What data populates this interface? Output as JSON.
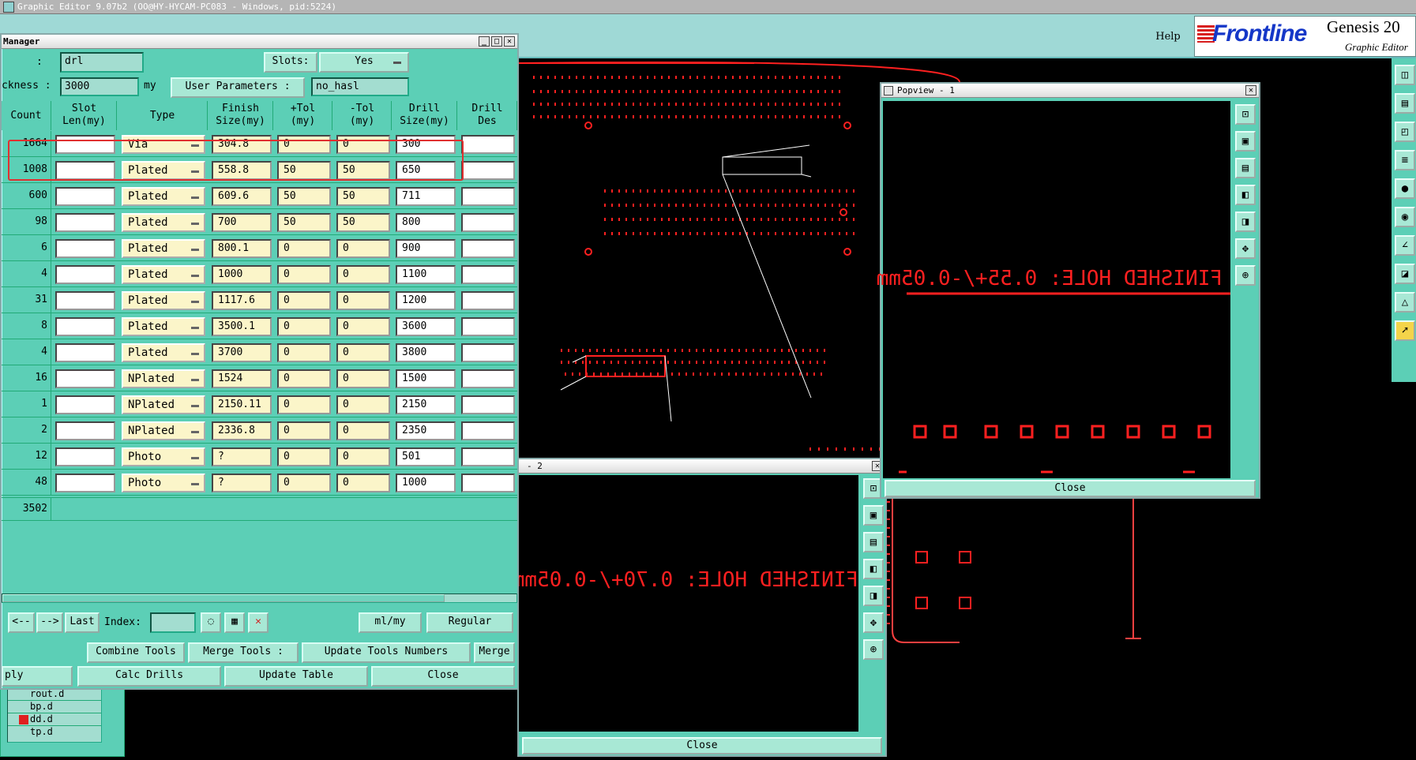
{
  "window": {
    "title": "Graphic Editor 9.07b2 (OO@HY-HYCAM-PC083 - Windows, pid:5224)",
    "help": "Help",
    "brand": "Frontline",
    "product": "Genesis 20",
    "product_sub": "Graphic Editor"
  },
  "tool_manager": {
    "title": "Manager",
    "field_layer": "drl",
    "layer_sep": ":",
    "slots_label": "Slots:",
    "slots_value": "Yes",
    "thickness_label": "ckness :",
    "thickness_value": "3000",
    "thickness_unit": "my",
    "user_params_label": "User Parameters :",
    "user_params_value": "no_hasl",
    "columns": [
      "Count",
      "Slot\nLen(my)",
      "Type",
      "Finish\nSize(my)",
      "+Tol\n(my)",
      "-Tol\n(my)",
      "Drill\nSize(my)",
      "Drill\nDes"
    ],
    "rows": [
      {
        "count": "1664",
        "type": "Via",
        "finish": "304.8",
        "ptol": "0",
        "mtol": "0",
        "drill": "300"
      },
      {
        "count": "1008",
        "type": "Plated",
        "finish": "558.8",
        "ptol": "50",
        "mtol": "50",
        "drill": "650"
      },
      {
        "count": "600",
        "type": "Plated",
        "finish": "609.6",
        "ptol": "50",
        "mtol": "50",
        "drill": "711"
      },
      {
        "count": "98",
        "type": "Plated",
        "finish": "700",
        "ptol": "50",
        "mtol": "50",
        "drill": "800"
      },
      {
        "count": "6",
        "type": "Plated",
        "finish": "800.1",
        "ptol": "0",
        "mtol": "0",
        "drill": "900"
      },
      {
        "count": "4",
        "type": "Plated",
        "finish": "1000",
        "ptol": "0",
        "mtol": "0",
        "drill": "1100"
      },
      {
        "count": "31",
        "type": "Plated",
        "finish": "1117.6",
        "ptol": "0",
        "mtol": "0",
        "drill": "1200"
      },
      {
        "count": "8",
        "type": "Plated",
        "finish": "3500.1",
        "ptol": "0",
        "mtol": "0",
        "drill": "3600"
      },
      {
        "count": "4",
        "type": "Plated",
        "finish": "3700",
        "ptol": "0",
        "mtol": "0",
        "drill": "3800"
      },
      {
        "count": "16",
        "type": "NPlated",
        "finish": "1524",
        "ptol": "0",
        "mtol": "0",
        "drill": "1500"
      },
      {
        "count": "1",
        "type": "NPlated",
        "finish": "2150.11",
        "ptol": "0",
        "mtol": "0",
        "drill": "2150"
      },
      {
        "count": "2",
        "type": "NPlated",
        "finish": "2336.8",
        "ptol": "0",
        "mtol": "0",
        "drill": "2350"
      },
      {
        "count": "12",
        "type": "Photo",
        "finish": "?",
        "ptol": "0",
        "mtol": "0",
        "drill": "501"
      },
      {
        "count": "48",
        "type": "Photo",
        "finish": "?",
        "ptol": "0",
        "mtol": "0",
        "drill": "1000"
      }
    ],
    "total": "3502",
    "nav": {
      "prev": "<--",
      "next": "-->",
      "last": "Last",
      "index_label": "Index:",
      "unit": "ml/my",
      "mode": "Regular"
    },
    "buttons": {
      "combine": "Combine Tools",
      "merge_tools": "Merge Tools :",
      "update_numbers": "Update Tools Numbers",
      "merge": "Merge",
      "apply": "ply",
      "calc": "Calc Drills",
      "update_table": "Update Table",
      "close": "Close"
    }
  },
  "layers": [
    "rout.d",
    "bp.d",
    "dd.d",
    "tp.d"
  ],
  "popview": {
    "title": "Popview - 1",
    "annotation": "FINISHED HOLE: 0.55+/-0.05mm",
    "close": "Close"
  },
  "popview2": {
    "title": "- 2",
    "annotation": "FINISHED HOLE: 0.70+/-0.05mm",
    "close": "Close"
  },
  "colors": {
    "panel": "#5ccfb6",
    "header": "#9fd9d6",
    "drawing": "#ff1a1a",
    "highlight": "#e03030"
  }
}
